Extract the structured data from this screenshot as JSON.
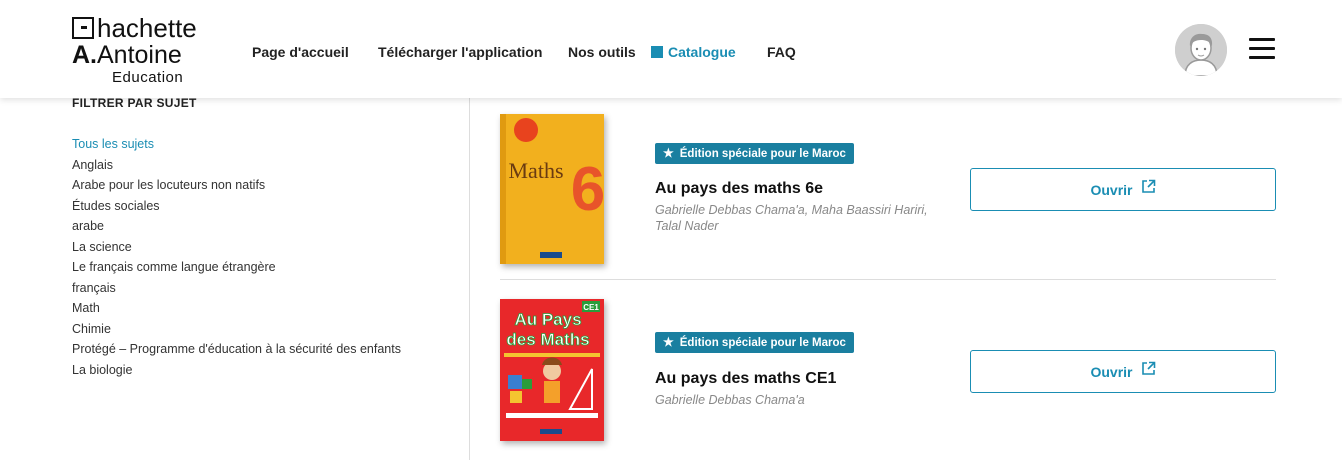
{
  "header": {
    "logo": {
      "line1": "hachette",
      "line2_bold": "A.",
      "line2": "Antoine",
      "line3": "Education"
    },
    "nav": [
      {
        "label": "Page d'accueil",
        "active": false
      },
      {
        "label": "Télécharger l'application",
        "active": false
      },
      {
        "label": "Nos outils",
        "active": false
      },
      {
        "label": "Catalogue",
        "active": true
      },
      {
        "label": "FAQ",
        "active": false
      }
    ],
    "icons": {
      "avatar": "user-avatar-icon",
      "menu": "hamburger-menu-icon"
    }
  },
  "sidebar": {
    "title": "FILTRER PAR SUJET",
    "subjects": [
      "Tous les sujets",
      "Anglais",
      "Arabe pour les locuteurs non natifs",
      "Études sociales",
      "arabe",
      "La science",
      "Le français comme langue étrangère",
      "français",
      "Math",
      "Chimie",
      "Protégé – Programme d'éducation à la sécurité des enfants",
      "La biologie"
    ],
    "active_subject": "Tous les sujets"
  },
  "books": [
    {
      "badge": "Édition spéciale pour le Maroc",
      "title": "Au pays des maths 6e",
      "authors": "Gabrielle Debbas Chama'a, Maha Baassiri Hariri, Talal Nader",
      "button": "Ouvrir",
      "cover": {
        "text": "Maths",
        "number": "6"
      }
    },
    {
      "badge": "Édition spéciale pour le Maroc",
      "title": "Au pays des maths CE1",
      "authors": "Gabrielle Debbas Chama'a",
      "button": "Ouvrir",
      "cover": {
        "text_line1": "Au Pays",
        "text_line2": "des Maths",
        "tag": "CE1"
      }
    }
  ],
  "colors": {
    "accent": "#1a8db3",
    "badge": "#1a7fa0",
    "cover1": "#f2b01e",
    "cover2": "#e8282a"
  }
}
